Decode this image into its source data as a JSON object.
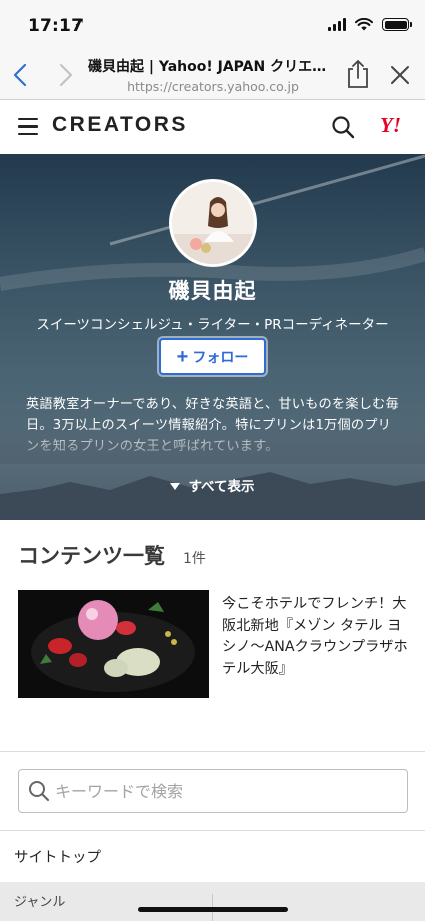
{
  "status_bar": {
    "time": "17:17",
    "location_arrow": "➚"
  },
  "browser": {
    "page_title": "磯貝由起 | Yahoo! JAPAN クリエイターズ",
    "url": "https://creators.yahoo.co.jp"
  },
  "site_header": {
    "logo": "CREATORS",
    "yahoo_logo": "Y!"
  },
  "profile": {
    "name": "磯貝由起",
    "role": "スイーツコンシェルジュ・ライター・PRコーディネーター",
    "follow_label": "フォロー",
    "bio": "英語教室オーナーであり、好きな英語と、甘いものを楽しむ毎日。3万以上のスイーツ情報紹介。特にプリンは1万個のプリンを知るプリンの女王と呼ばれています。",
    "show_all_label": "すべて表示"
  },
  "contents": {
    "heading": "コンテンツ一覧",
    "count": "1件",
    "articles": [
      {
        "title": "今こそホテルでフレンチ！大阪北新地『メゾン タテル ヨシノ〜ANAクラウンプラザホテル大阪』"
      }
    ]
  },
  "search": {
    "placeholder": "キーワードで検索"
  },
  "footer": {
    "site_top": "サイトトップ",
    "genre": "ジャンル"
  },
  "colors": {
    "accent": "#2d6bd6",
    "yahoo_red": "#e60023"
  }
}
